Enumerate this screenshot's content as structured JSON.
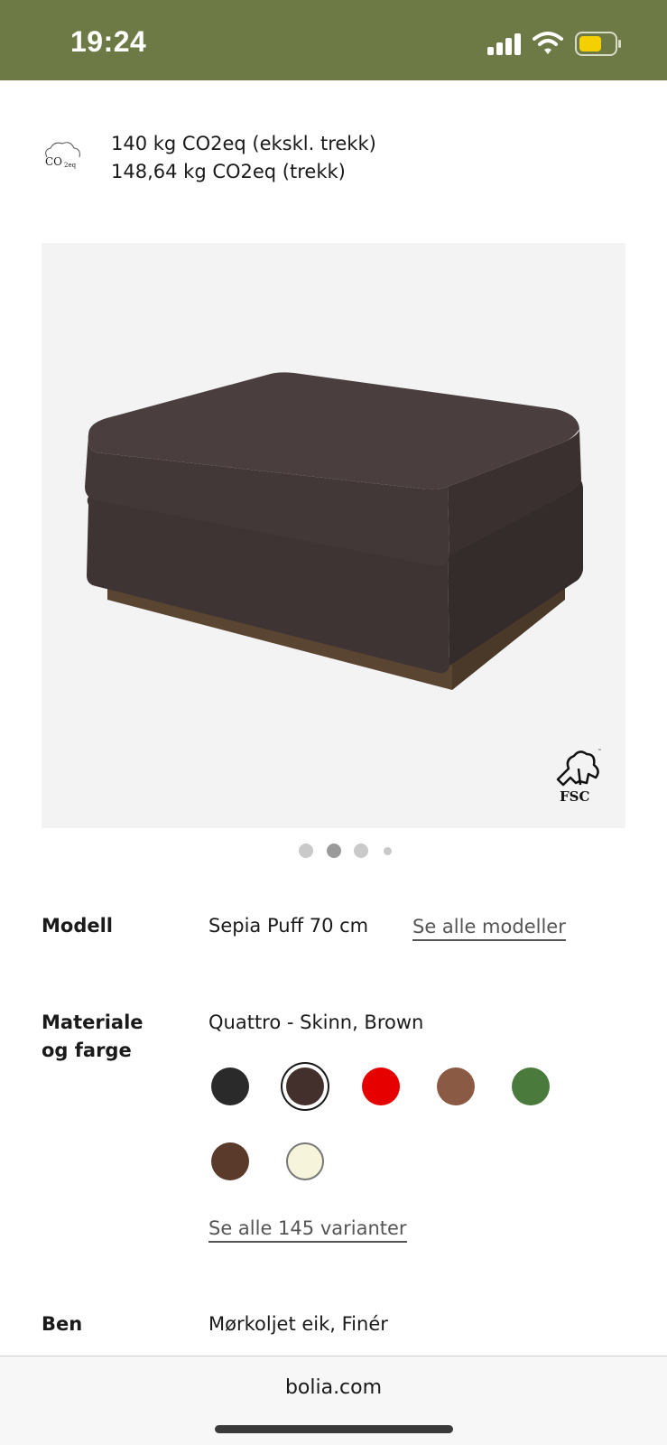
{
  "status_bar": {
    "time": "19:24",
    "bg_color": "#6e7a45",
    "icons": [
      "signal-icon",
      "wifi-icon",
      "battery-icon"
    ],
    "battery_color": "#f5d000"
  },
  "co2": {
    "icon_label": "CO",
    "icon_sub": "2eq",
    "line1": "140 kg CO2eq (ekskl. trekk)",
    "line2": "148,64 kg CO2eq (trekk)"
  },
  "gallery": {
    "fsc_label": "FSC",
    "dot_count": 4,
    "active_dot": 2
  },
  "model": {
    "label": "Modell",
    "value": "Sepia Puff 70 cm",
    "link": "Se alle modeller"
  },
  "material": {
    "label_line1": "Materiale",
    "label_line2": "og farge",
    "value": "Quattro - Skinn, Brown",
    "swatches": [
      {
        "color": "#2a2a2a",
        "selected": false
      },
      {
        "color": "#43302c",
        "selected": true
      },
      {
        "color": "#e60000",
        "selected": false
      },
      {
        "color": "#8b5a45",
        "selected": false
      },
      {
        "color": "#4a7a3c",
        "selected": false
      },
      {
        "color": "#5a3a2a",
        "selected": false
      },
      {
        "color": "#f6f5dc",
        "selected": false
      }
    ],
    "link": "Se alle 145 varianter"
  },
  "legs": {
    "label": "Ben",
    "value": "Mørkoljet eik, Finér"
  },
  "browser": {
    "url": "bolia.com"
  }
}
